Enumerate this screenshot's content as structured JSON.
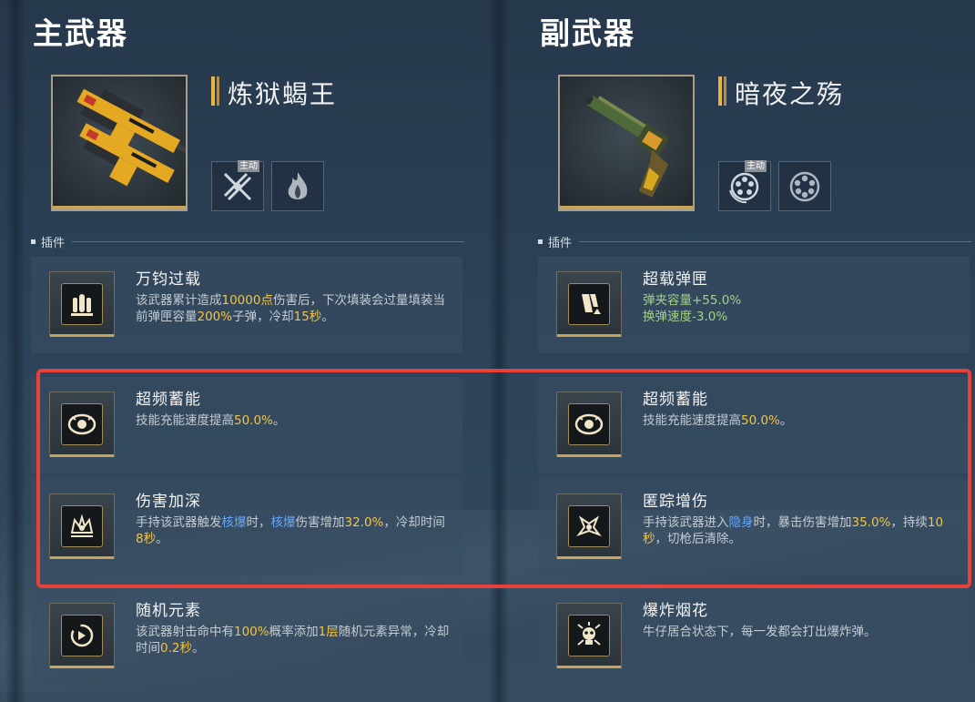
{
  "primary": {
    "title": "主武器",
    "weapon_name": "炼狱蝎王",
    "skills": [
      {
        "icon": "crossed-guns-icon",
        "tag": "主动"
      },
      {
        "icon": "flame-icon",
        "tag": ""
      }
    ],
    "plugins_label": "插件",
    "plugins": [
      {
        "name": "万钧过载",
        "icon": "bullets-icon",
        "desc": [
          {
            "t": "该武器累计造成",
            "c": ""
          },
          {
            "t": "10000点",
            "c": "y"
          },
          {
            "t": "伤害后，下次填装会过量填装当前弹匣容量",
            "c": ""
          },
          {
            "t": "200%",
            "c": "y"
          },
          {
            "t": "子弹，冷却",
            "c": ""
          },
          {
            "t": "15秒",
            "c": "y"
          },
          {
            "t": "。",
            "c": ""
          }
        ]
      },
      {
        "name": "超频蓄能",
        "icon": "eye-icon",
        "desc": [
          {
            "t": "技能充能速度提高",
            "c": ""
          },
          {
            "t": "50.0%",
            "c": "y"
          },
          {
            "t": "。",
            "c": ""
          }
        ]
      },
      {
        "name": "伤害加深",
        "icon": "crown-burst-icon",
        "desc": [
          {
            "t": "手持该武器触发",
            "c": ""
          },
          {
            "t": "核爆",
            "c": "b"
          },
          {
            "t": "时，",
            "c": ""
          },
          {
            "t": "核爆",
            "c": "b"
          },
          {
            "t": "伤害增加",
            "c": ""
          },
          {
            "t": "32.0%",
            "c": "y"
          },
          {
            "t": "，冷却时间",
            "c": ""
          },
          {
            "t": "8秒",
            "c": "y"
          },
          {
            "t": "。",
            "c": ""
          }
        ]
      },
      {
        "name": "随机元素",
        "icon": "element-swirl-icon",
        "desc": [
          {
            "t": "该武器射击命中有",
            "c": ""
          },
          {
            "t": "100%",
            "c": "y"
          },
          {
            "t": "概率添加",
            "c": ""
          },
          {
            "t": "1层",
            "c": "y"
          },
          {
            "t": "随机元素异常，冷却时间",
            "c": ""
          },
          {
            "t": "0.2秒",
            "c": "y"
          },
          {
            "t": "。",
            "c": ""
          }
        ]
      }
    ]
  },
  "secondary": {
    "title": "副武器",
    "weapon_name": "暗夜之殇",
    "skills": [
      {
        "icon": "revolver-cylinder-spin-icon",
        "tag": "主动"
      },
      {
        "icon": "revolver-cylinder-icon",
        "tag": ""
      }
    ],
    "plugins_label": "插件",
    "plugins": [
      {
        "name": "超载弹匣",
        "icon": "magazine-up-icon",
        "desc": [
          {
            "t": "弹夹容量+55.0%",
            "c": "g",
            "br": true
          },
          {
            "t": "换弹速度-3.0%",
            "c": "g"
          }
        ]
      },
      {
        "name": "超频蓄能",
        "icon": "eye-icon",
        "desc": [
          {
            "t": "技能充能速度提高",
            "c": ""
          },
          {
            "t": "50.0%",
            "c": "y"
          },
          {
            "t": "。",
            "c": ""
          }
        ]
      },
      {
        "name": "匿踪增伤",
        "icon": "stealth-burst-icon",
        "desc": [
          {
            "t": "手持该武器进入",
            "c": ""
          },
          {
            "t": "隐身",
            "c": "b"
          },
          {
            "t": "时，暴击伤害增加",
            "c": ""
          },
          {
            "t": "35.0%",
            "c": "y"
          },
          {
            "t": "，持续",
            "c": ""
          },
          {
            "t": "10秒",
            "c": "y"
          },
          {
            "t": "，切枪后清除。",
            "c": ""
          }
        ]
      },
      {
        "name": "爆炸烟花",
        "icon": "firework-skull-icon",
        "desc": [
          {
            "t": "牛仔居合状态下，每一发都会打出爆炸弹。",
            "c": ""
          }
        ]
      }
    ]
  },
  "colors": {
    "highlight_yellow": "#f1c547",
    "highlight_blue": "#66a8ff",
    "highlight_green": "#a3d28a",
    "selection_frame": "#e8413c"
  }
}
